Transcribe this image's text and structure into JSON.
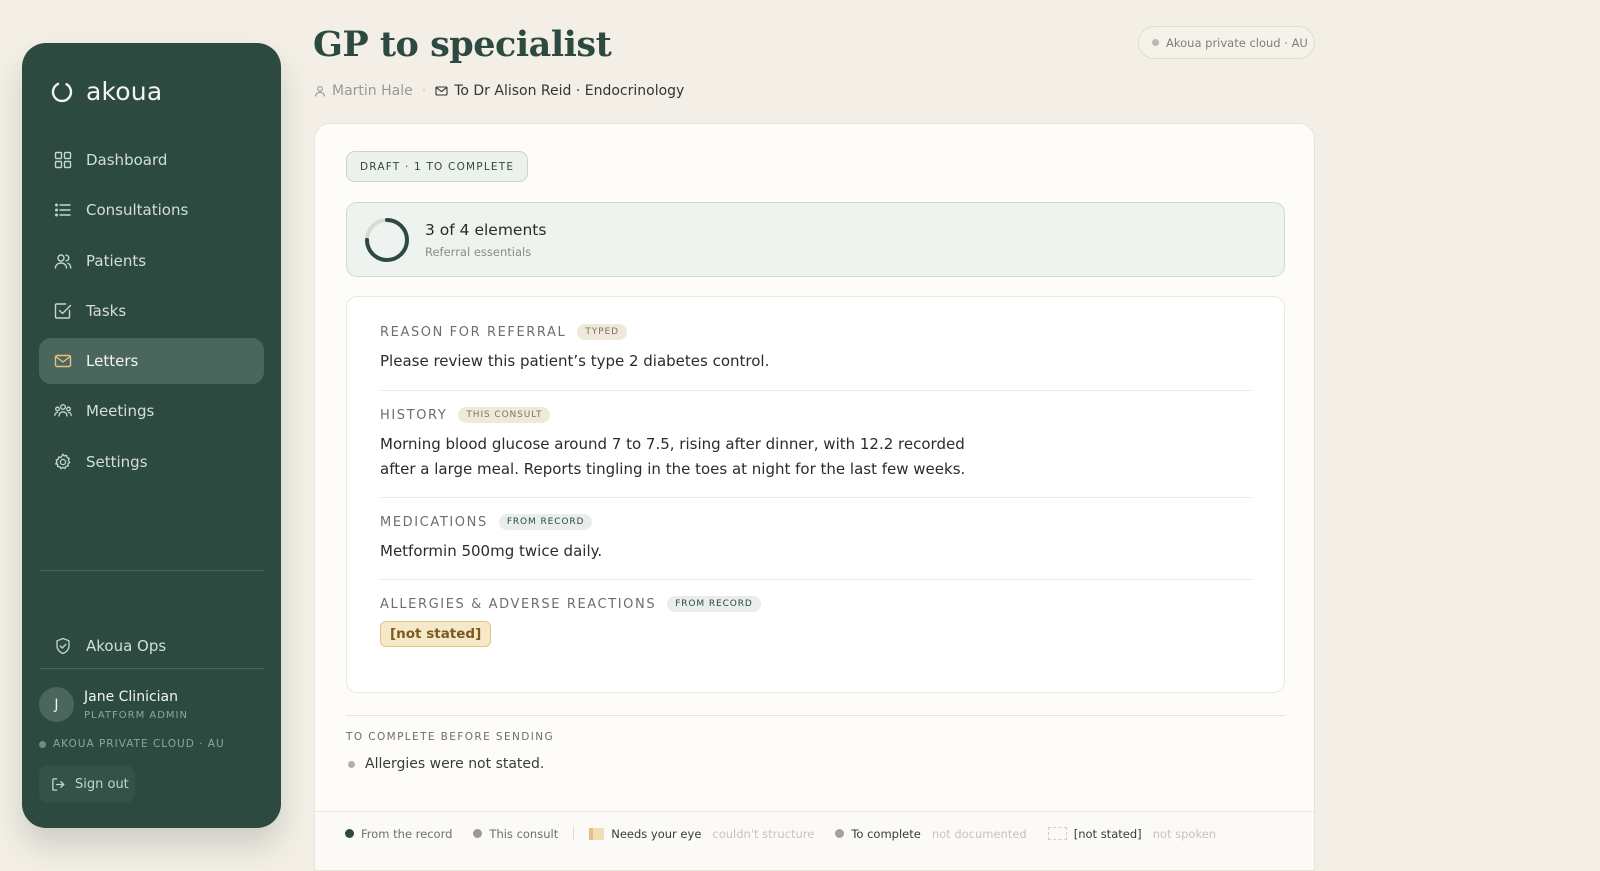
{
  "sidebar": {
    "brand": "akoua",
    "nav": [
      {
        "label": "Dashboard",
        "icon": "grid-icon"
      },
      {
        "label": "Consultations",
        "icon": "list-icon"
      },
      {
        "label": "Patients",
        "icon": "users-icon"
      },
      {
        "label": "Tasks",
        "icon": "checkbox-icon"
      },
      {
        "label": "Letters",
        "icon": "mail-icon",
        "active": true
      },
      {
        "label": "Meetings",
        "icon": "group-icon"
      },
      {
        "label": "Settings",
        "icon": "gear-icon"
      }
    ],
    "ops_label": "Akoua Ops",
    "user": {
      "initial": "J",
      "name": "Jane Clinician",
      "role": "PLATFORM ADMIN"
    },
    "cloud": "AKOUA PRIVATE CLOUD · AU",
    "sign_out": "Sign out"
  },
  "header": {
    "title": "GP to specialist",
    "patient": "Martin Hale",
    "separator": "·",
    "recipient": "To Dr Alison Reid · Endocrinology",
    "cloud_pill": "Akoua private cloud · AU"
  },
  "card": {
    "status": "DRAFT · 1 TO COMPLETE",
    "progress": {
      "title": "3 of 4 elements",
      "subtitle": "Referral essentials",
      "completed": 3,
      "total": 4
    },
    "sections": [
      {
        "label": "REASON FOR REFERRAL",
        "tag": "TYPED",
        "text": "Please review this patient’s type 2 diabetes control."
      },
      {
        "label": "HISTORY",
        "tag": "THIS CONSULT",
        "text": "Morning blood glucose around 7 to 7.5, rising after dinner, with 12.2 recorded after a large meal. Reports tingling in the toes at night for the last few weeks."
      },
      {
        "label": "MEDICATIONS",
        "tag": "FROM RECORD",
        "text": "Metformin 500mg twice daily."
      },
      {
        "label": "ALLERGIES & ADVERSE REACTIONS",
        "tag": "FROM RECORD",
        "value": "[not stated]"
      }
    ],
    "todo_label": "TO COMPLETE BEFORE SENDING",
    "todo_items": [
      "Allergies were not stated."
    ]
  },
  "legend": {
    "from_record": "From the record",
    "this_consult": "This consult",
    "needs_eye": "Needs your eye",
    "needs_eye_note": "couldn't structure",
    "to_complete": "To complete",
    "to_complete_note": "not documented",
    "not_stated": "[not stated]",
    "not_stated_note": "not spoken"
  },
  "colors": {
    "sidebar_bg": "#2d4a41",
    "accent_green": "#2d4a41",
    "warning_fill": "#f7e8c7",
    "warning_border": "#e0c38a",
    "background": "#f3efe6"
  }
}
